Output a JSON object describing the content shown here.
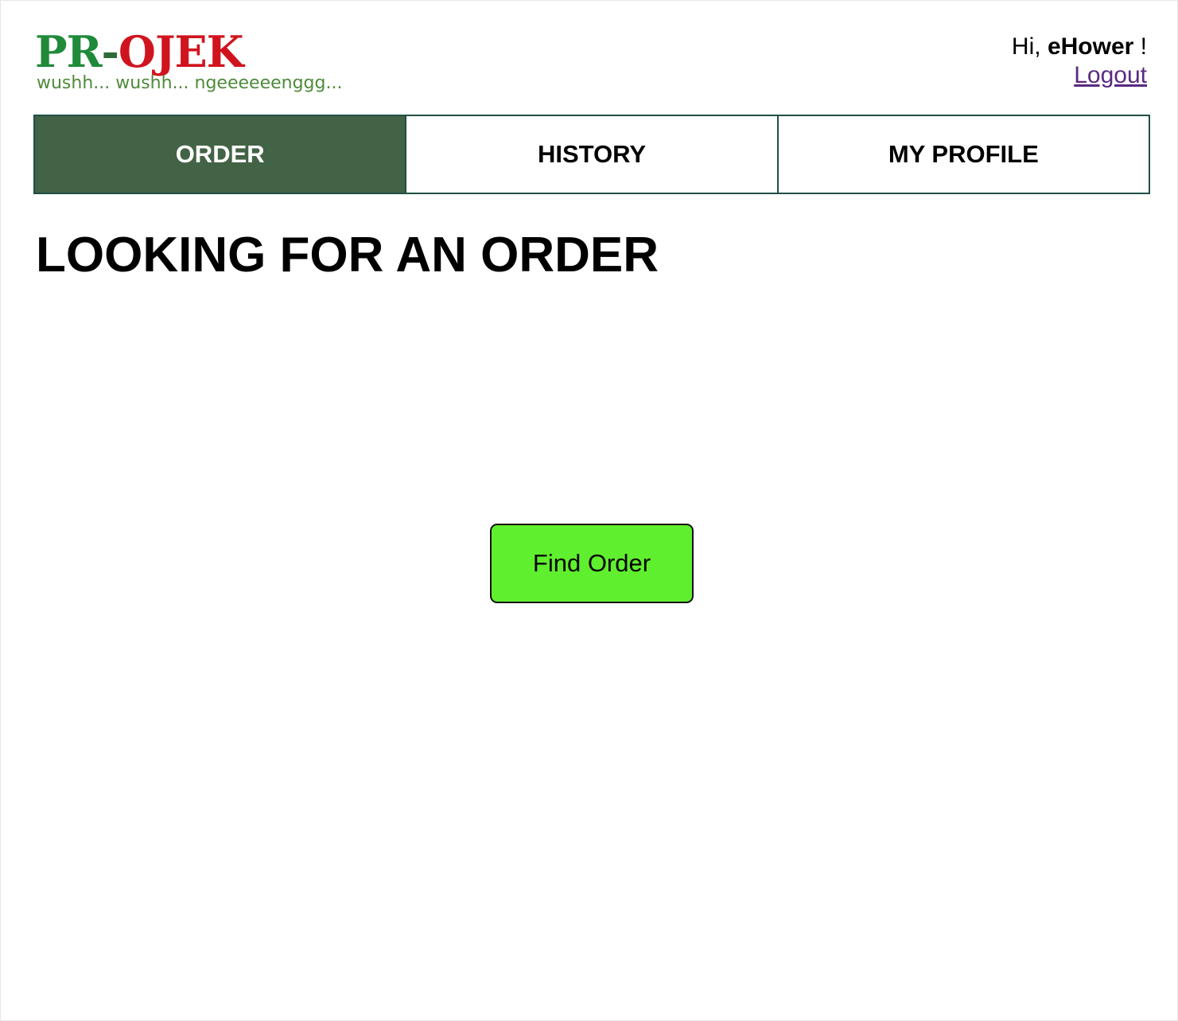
{
  "logo": {
    "pr": "PR",
    "dash": "-",
    "ojek": "OJEK",
    "tagline": "wushh... wushh... ngeeeeeenggg..."
  },
  "user": {
    "greeting": "Hi,",
    "username": "eHower",
    "exclamation": "!",
    "logout_label": "Logout"
  },
  "tabs": [
    {
      "label": "ORDER",
      "active": true
    },
    {
      "label": "HISTORY",
      "active": false
    },
    {
      "label": "MY PROFILE",
      "active": false
    }
  ],
  "main": {
    "title": "LOOKING FOR AN ORDER",
    "find_button_label": "Find Order"
  },
  "colors": {
    "logo_pr": "#1f8a3a",
    "logo_ojek": "#d0141e",
    "tagline": "#4f8a3a",
    "active_tab_bg": "#436346",
    "tab_border": "#1f4f45",
    "find_button_bg": "#60ef2e",
    "logout_link": "#5a2a82"
  }
}
